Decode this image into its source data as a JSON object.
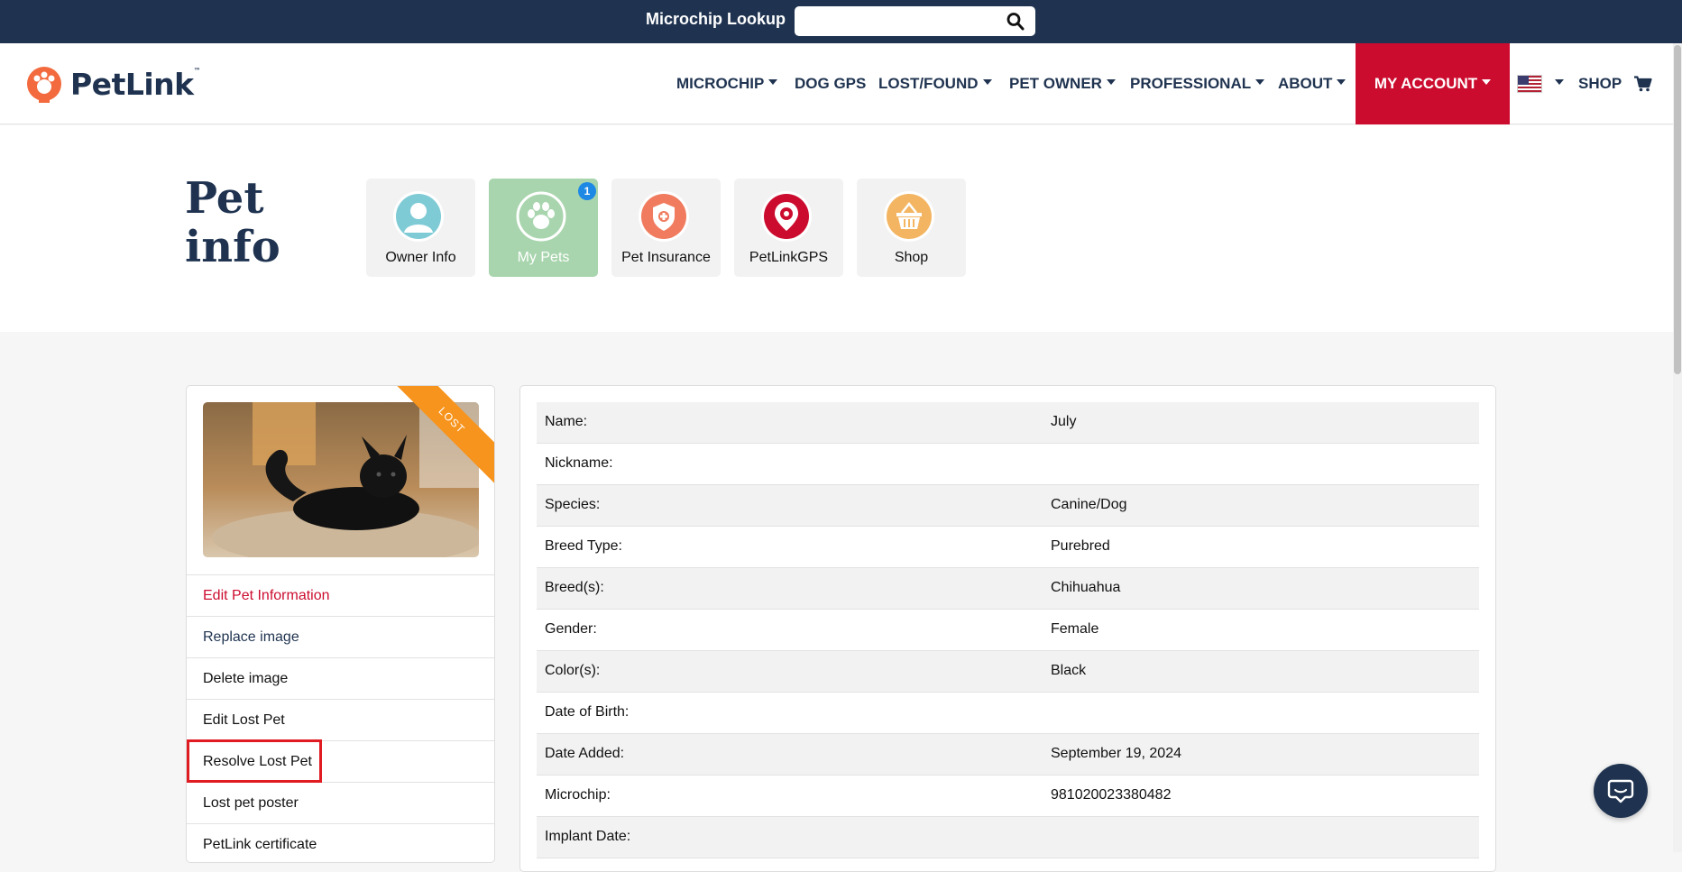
{
  "topbar": {
    "label": "Microchip Lookup",
    "search_value": "",
    "search_icon": "search-icon"
  },
  "header": {
    "logo": "PetLink",
    "logo_tm": "™",
    "nav": {
      "microchip": "MICROCHIP",
      "dog_gps": "DOG GPS",
      "lost_found": "LOST/FOUND",
      "pet_owner": "PET OWNER",
      "professional": "PROFESSIONAL",
      "about": "ABOUT",
      "my_account": "MY ACCOUNT",
      "shop": "SHOP"
    },
    "flag_icon": "us-flag-icon",
    "cart_icon": "cart-icon"
  },
  "hero": {
    "title": "Pet info",
    "tiles": {
      "owner_info": "Owner Info",
      "my_pets": "My Pets",
      "my_pets_badge": "1",
      "pet_insurance": "Pet Insurance",
      "petlink_gps": "PetLinkGPS",
      "shop": "Shop"
    }
  },
  "pet": {
    "ribbon": "LOST",
    "actions": {
      "edit": "Edit Pet Information",
      "replace": "Replace image",
      "delete": "Delete image",
      "edit_lost": "Edit Lost Pet",
      "resolve_lost": "Resolve Lost Pet",
      "poster": "Lost pet poster",
      "certificate": "PetLink certificate"
    }
  },
  "details": [
    {
      "key": "Name:",
      "value": "July"
    },
    {
      "key": "Nickname:",
      "value": ""
    },
    {
      "key": "Species:",
      "value": "Canine/Dog"
    },
    {
      "key": "Breed Type:",
      "value": "Purebred"
    },
    {
      "key": "Breed(s):",
      "value": "Chihuahua"
    },
    {
      "key": "Gender:",
      "value": "Female"
    },
    {
      "key": "Color(s):",
      "value": "Black"
    },
    {
      "key": "Date of Birth:",
      "value": ""
    },
    {
      "key": "Date Added:",
      "value": "September 19, 2024"
    },
    {
      "key": "Microchip:",
      "value": "981020023380482"
    },
    {
      "key": "Implant Date:",
      "value": ""
    }
  ],
  "colors": {
    "navy": "#1f3350",
    "brand_red": "#cc0c2f",
    "active_tile": "#a8d5ad",
    "lost_ribbon": "#f7941d",
    "badge_blue": "#1e88e5",
    "highlight_red": "#e11b22"
  }
}
